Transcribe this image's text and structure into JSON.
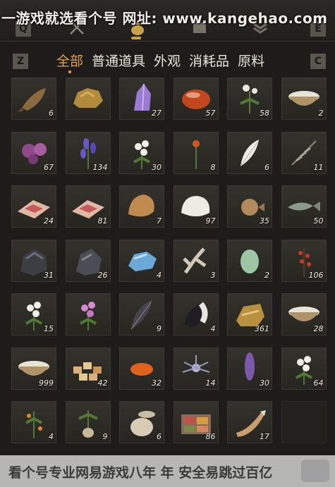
{
  "watermark": {
    "top": "一游戏就选看个号  网址: www.kangehao.com",
    "bottom": "看个号专业网易游戏八年 年  安全易跳过百亿"
  },
  "top_keys": {
    "left": "Q",
    "right": "E"
  },
  "filter": {
    "left_key": "Z",
    "right_key": "C",
    "tabs": [
      "全部",
      "普通道具",
      "外观",
      "消耗品",
      "原料"
    ],
    "active_index": 0
  },
  "items": [
    {
      "icon": "fish-icon",
      "count": "6"
    },
    {
      "icon": "ore-chunk-icon",
      "count": ""
    },
    {
      "icon": "amethyst-icon",
      "count": "27"
    },
    {
      "icon": "red-gem-icon",
      "count": "57"
    },
    {
      "icon": "white-herb-icon",
      "count": "58"
    },
    {
      "icon": "bowl-icon",
      "count": "2"
    },
    {
      "icon": "purple-flower-icon",
      "count": "67"
    },
    {
      "icon": "lavender-icon",
      "count": "134"
    },
    {
      "icon": "white-flower-icon",
      "count": "30"
    },
    {
      "icon": "red-flower-icon",
      "count": "8"
    },
    {
      "icon": "feather-icon",
      "count": "6"
    },
    {
      "icon": "dried-herb-icon",
      "count": "11"
    },
    {
      "icon": "raw-meat-icon",
      "count": "24"
    },
    {
      "icon": "raw-meat-icon",
      "count": "81"
    },
    {
      "icon": "fur-pelt-icon",
      "count": "7"
    },
    {
      "icon": "white-pelt-icon",
      "count": "97"
    },
    {
      "icon": "pufferfish-icon",
      "count": "35"
    },
    {
      "icon": "river-fish-icon",
      "count": "50"
    },
    {
      "icon": "dark-ore-icon",
      "count": "31"
    },
    {
      "icon": "iron-ore-icon",
      "count": "26"
    },
    {
      "icon": "blue-crystal-icon",
      "count": "4"
    },
    {
      "icon": "coral-icon",
      "count": "3"
    },
    {
      "icon": "green-egg-icon",
      "count": "2"
    },
    {
      "icon": "berry-branch-icon",
      "count": "106"
    },
    {
      "icon": "white-flower-icon",
      "count": "15"
    },
    {
      "icon": "pink-flower-icon",
      "count": ""
    },
    {
      "icon": "black-feather-icon",
      "count": "9"
    },
    {
      "icon": "tail-icon",
      "count": "4"
    },
    {
      "icon": "gold-ingot-icon",
      "count": "361"
    },
    {
      "icon": "bowl-icon",
      "count": "28"
    },
    {
      "icon": "bowl-icon",
      "count": "999"
    },
    {
      "icon": "snack-pile-icon",
      "count": "42"
    },
    {
      "icon": "orange-seed-icon",
      "count": "32"
    },
    {
      "icon": "spiky-flower-icon",
      "count": "14"
    },
    {
      "icon": "purple-spike-icon",
      "count": "30"
    },
    {
      "icon": "white-flower-icon",
      "count": "64"
    },
    {
      "icon": "orange-plant-icon",
      "count": "4"
    },
    {
      "icon": "root-icon",
      "count": "9"
    },
    {
      "icon": "jar-icon",
      "count": "6"
    },
    {
      "icon": "spice-box-icon",
      "count": "86"
    },
    {
      "icon": "horn-icon",
      "count": "17"
    },
    {
      "icon": "empty-slot",
      "count": ""
    }
  ],
  "colors": {
    "active_tab": "#e8a04a",
    "panel_bg": "#1d1c1a",
    "cell_bg": "#2e2c27"
  }
}
